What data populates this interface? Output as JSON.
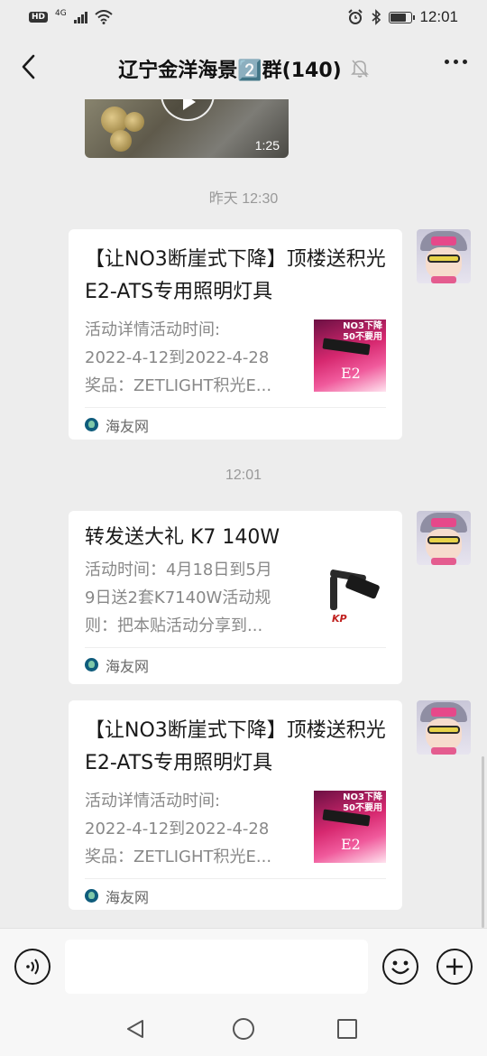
{
  "status_bar": {
    "hd_label": "HD",
    "network_label": "4G",
    "time": "12:01",
    "battery_level": 0.75
  },
  "header": {
    "title": "辽宁金洋海景2️⃣群(140)",
    "icons": [
      "back-arrow-icon",
      "muted-bell-icon",
      "more-dots-icon"
    ]
  },
  "chat": {
    "top_video": {
      "duration": "1:25"
    },
    "timestamps": [
      "昨天 12:30",
      "12:01"
    ],
    "messages": [
      {
        "title": "【让NO3断崖式下降】顶楼送积光E2-ATS专用照明灯具",
        "desc": [
          "活动详情活动时间:",
          "2022-4-12到2022-4-28",
          "奖品：ZETLIGHT积光E..."
        ],
        "thumb_banner": [
          "NO3下降",
          "50不要用"
        ],
        "thumb_text": "E2",
        "source": "海友网"
      },
      {
        "title": "转发送大礼 K7 140W",
        "desc": [
          "活动时间：4月18日到5月",
          "9日送2套K7140W活动规",
          "则：把本贴活动分享到..."
        ],
        "thumb_text": "KP",
        "source": "海友网"
      },
      {
        "title": "【让NO3断崖式下降】顶楼送积光E2-ATS专用照明灯具",
        "desc": [
          "活动详情活动时间:",
          "2022-4-12到2022-4-28",
          "奖品：ZETLIGHT积光E..."
        ],
        "thumb_banner": [
          "NO3下降",
          "50不要用"
        ],
        "thumb_text": "E2",
        "source": "海友网"
      }
    ]
  },
  "input_bar": {
    "icons": [
      "voice-icon",
      "emoji-icon",
      "plus-icon"
    ],
    "text_value": ""
  },
  "nav_bar": {
    "icons": [
      "nav-back-icon",
      "nav-home-icon",
      "nav-recents-icon"
    ]
  },
  "colors": {
    "background": "#ededed",
    "card": "#ffffff",
    "muted_text": "#888888",
    "timestamp_text": "#999999"
  }
}
